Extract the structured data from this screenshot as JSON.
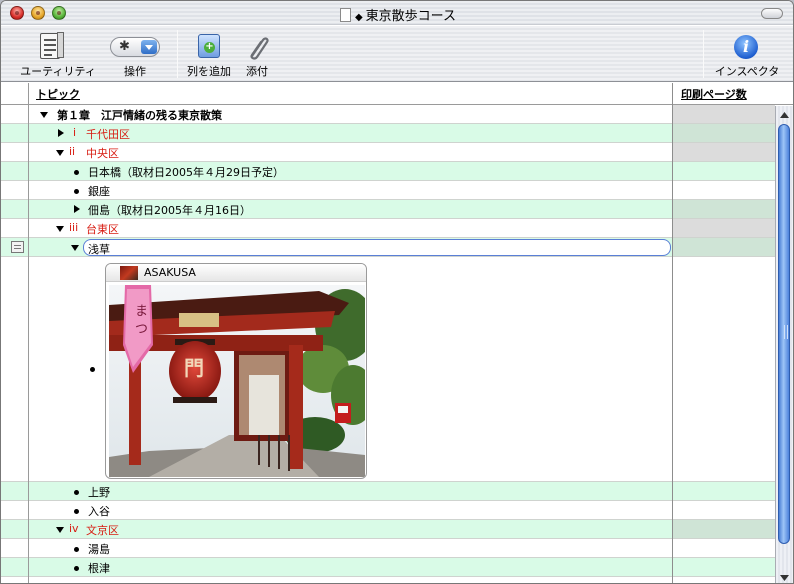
{
  "window": {
    "title": "東京散歩コース"
  },
  "toolbar": {
    "utility_label": "ユーティリティ",
    "action_label": "操作",
    "add_column_label": "列を追加",
    "attach_label": "添付",
    "inspector_label": "インスペクタ"
  },
  "columns": {
    "topic": "トピック",
    "print_pages": "印刷ページ数"
  },
  "rows": [
    {
      "text": "第１章　江戸情緒の残る東京散策",
      "marker": "",
      "toggle": "expanded",
      "bold": true
    },
    {
      "text": "千代田区",
      "marker": "i",
      "toggle": "collapsed"
    },
    {
      "text": "中央区",
      "marker": "ii",
      "toggle": "expanded"
    },
    {
      "text": "日本橋（取材日2005年４月29日予定）",
      "marker": "bullet"
    },
    {
      "text": "銀座",
      "marker": "bullet"
    },
    {
      "text": "佃島（取材日2005年４月16日）",
      "marker": "",
      "toggle": "collapsed"
    },
    {
      "text": "台東区",
      "marker": "iii",
      "toggle": "expanded"
    },
    {
      "text": "浅草",
      "marker": "",
      "toggle": "expanded",
      "editing": true
    },
    {
      "text": "上野",
      "marker": "bullet"
    },
    {
      "text": "入谷",
      "marker": "bullet"
    },
    {
      "text": "文京区",
      "marker": "iv",
      "toggle": "expanded"
    },
    {
      "text": "湯島",
      "marker": "bullet"
    },
    {
      "text": "根津",
      "marker": "bullet"
    }
  ],
  "image_attachment": {
    "caption": "ASAKUSA",
    "icon": "photo-thumbnail-icon"
  },
  "colors": {
    "row_alt": "#d9fbe7",
    "roman_numeral": "#d81c12",
    "accent_blue": "#2f6ec7"
  },
  "icons": {
    "close": "close-icon",
    "minimize": "minimize-icon",
    "zoom": "zoom-icon",
    "utility": "utility-icon",
    "action": "gear-icon",
    "add_column": "add-column-icon",
    "attach": "paperclip-icon",
    "inspector": "info-icon"
  }
}
